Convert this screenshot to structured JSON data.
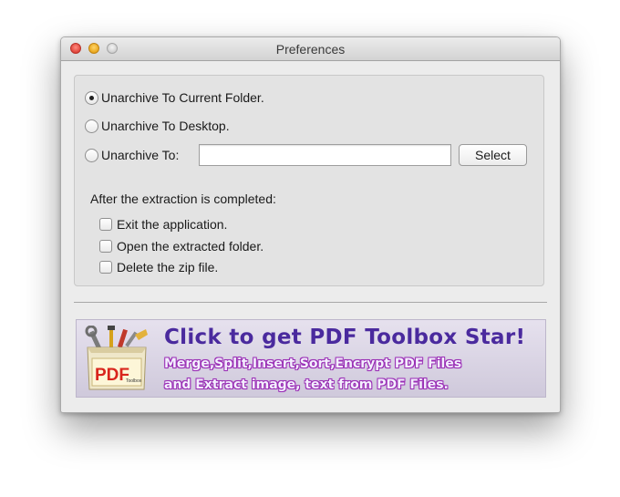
{
  "window": {
    "title": "Preferences"
  },
  "destination": {
    "options": [
      {
        "label": "Unarchive To Current Folder.",
        "selected": true
      },
      {
        "label": "Unarchive To Desktop.",
        "selected": false
      },
      {
        "label": "Unarchive To:",
        "selected": false
      }
    ],
    "path_value": "",
    "select_label": "Select"
  },
  "after": {
    "label": "After the extraction is completed:",
    "options": [
      {
        "label": "Exit the application.",
        "checked": false
      },
      {
        "label": "Open the extracted folder.",
        "checked": false
      },
      {
        "label": "Delete the zip file.",
        "checked": false
      }
    ]
  },
  "banner": {
    "logo_text": "PDF",
    "logo_subtext": "Toolbox",
    "title": "Click to get PDF Toolbox Star!",
    "line1": "Merge,Split,Insert,Sort,Encrypt PDF Files",
    "line2": "and Extract image, text from PDF Files."
  },
  "colors": {
    "banner_title": "#4a2a9e",
    "banner_text_outline": "#9a2fb5",
    "close": "#e0443a",
    "minimize": "#e9a71c"
  }
}
